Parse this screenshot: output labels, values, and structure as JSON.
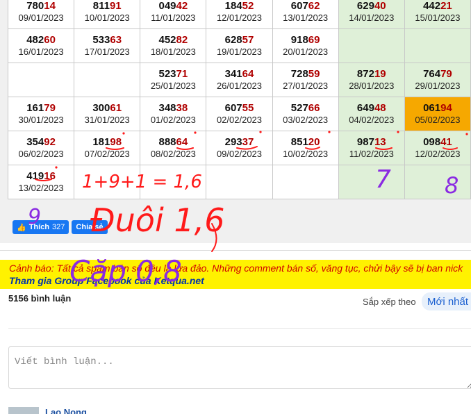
{
  "table": {
    "rows": [
      [
        {
          "head": "780",
          "tail": "14",
          "date": "09/01/2023"
        },
        {
          "head": "811",
          "tail": "91",
          "date": "10/01/2023"
        },
        {
          "head": "049",
          "tail": "42",
          "date": "11/01/2023"
        },
        {
          "head": "184",
          "tail": "52",
          "date": "12/01/2023"
        },
        {
          "head": "607",
          "tail": "62",
          "date": "13/01/2023"
        },
        {
          "head": "629",
          "tail": "40",
          "date": "14/01/2023",
          "weekend": true
        },
        {
          "head": "442",
          "tail": "21",
          "date": "15/01/2023",
          "weekend": true
        }
      ],
      [
        {
          "head": "482",
          "tail": "60",
          "date": "16/01/2023"
        },
        {
          "head": "533",
          "tail": "63",
          "date": "17/01/2023"
        },
        {
          "head": "452",
          "tail": "82",
          "date": "18/01/2023"
        },
        {
          "head": "628",
          "tail": "57",
          "date": "19/01/2023"
        },
        {
          "head": "918",
          "tail": "69",
          "date": "20/01/2023"
        },
        {
          "weekend": true
        },
        {
          "weekend": true
        }
      ],
      [
        {},
        {},
        {
          "head": "523",
          "tail": "71",
          "date": "25/01/2023"
        },
        {
          "head": "341",
          "tail": "64",
          "date": "26/01/2023"
        },
        {
          "head": "728",
          "tail": "59",
          "date": "27/01/2023"
        },
        {
          "head": "872",
          "tail": "19",
          "date": "28/01/2023",
          "weekend": true
        },
        {
          "head": "764",
          "tail": "79",
          "date": "29/01/2023",
          "weekend": true
        }
      ],
      [
        {
          "head": "161",
          "tail": "79",
          "date": "30/01/2023"
        },
        {
          "head": "300",
          "tail": "61",
          "date": "31/01/2023"
        },
        {
          "head": "348",
          "tail": "38",
          "date": "01/02/2023"
        },
        {
          "head": "607",
          "tail": "55",
          "date": "02/02/2023"
        },
        {
          "head": "527",
          "tail": "66",
          "date": "03/02/2023"
        },
        {
          "head": "649",
          "tail": "48",
          "date": "04/02/2023",
          "weekend": true
        },
        {
          "head": "061",
          "tail": "94",
          "date": "05/02/2023",
          "hot": true
        }
      ],
      [
        {
          "head": "354",
          "tail": "92",
          "date": "06/02/2023"
        },
        {
          "head": "181",
          "tail": "98",
          "date": "07/02/2023"
        },
        {
          "head": "888",
          "tail": "64",
          "date": "08/02/2023"
        },
        {
          "head": "293",
          "tail": "37",
          "date": "09/02/2023"
        },
        {
          "head": "851",
          "tail": "20",
          "date": "10/02/2023"
        },
        {
          "head": "987",
          "tail": "13",
          "date": "11/02/2023",
          "weekend": true
        },
        {
          "head": "098",
          "tail": "41",
          "date": "12/02/2023",
          "weekend": true
        }
      ],
      [
        {
          "head": "419",
          "tail": "16",
          "date": "13/02/2023"
        },
        {},
        {},
        {},
        {},
        {
          "weekend": true
        },
        {
          "weekend": true
        }
      ]
    ]
  },
  "social": {
    "like_label": "Thích",
    "like_count": "327",
    "share_label": "Chia sẻ"
  },
  "warning": {
    "label": "Cảnh báo:",
    "message": " Tất cả spam bán số đều là lừa đảo. Những comment bán số, văng tục, chửi bậy sẽ bị ban nick",
    "group_link": "Tham gia Group Facebook của Ketqua.net"
  },
  "comments": {
    "count_label": "5156 bình luận",
    "sort_label": "Sắp xếp theo",
    "sort_value": "Mới nhất",
    "input_placeholder": "Viết bình luận...",
    "first_commenter": "Lao Nong"
  },
  "annotations": {
    "sum": "1+9+1 = 1,6",
    "dui": "Đuôi 1,6",
    "cap": "Cặp 0,8",
    "num_9": "9",
    "num_7": "7",
    "num_8": "8"
  },
  "colors": {
    "weekend_bg": "#dff0d8",
    "hot_bg": "#f6a800",
    "tail_red": "#b00000",
    "ink_red": "#ff1a1a",
    "ink_purple": "#8a2be2",
    "warning_bg": "#fff200",
    "facebook_blue": "#1877f2"
  }
}
